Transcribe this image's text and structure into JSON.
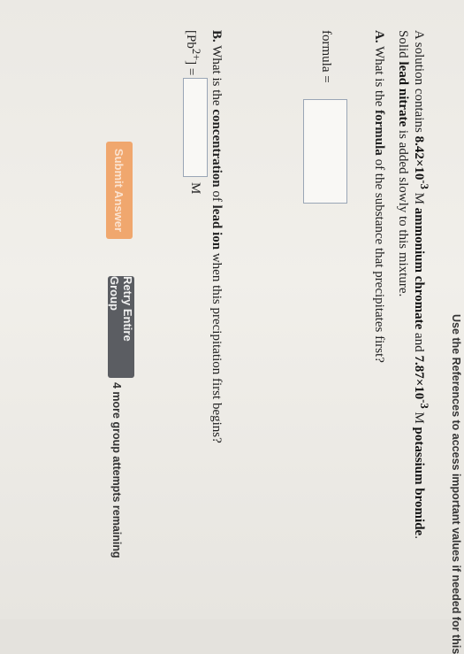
{
  "header": {
    "references_text": "Use the References to access important values if needed for this"
  },
  "problem": {
    "t1": "A solution contains ",
    "b1": "8.42×10",
    "e1": "-3",
    "t2": " M ",
    "b2": "ammonium chromate",
    "t3": " and ",
    "b3": "7.87×10",
    "e3": "-3",
    "t4": " M ",
    "b4": "potassium bromide",
    "t5": ".",
    "t6": "Solid ",
    "b6": "lead nitrate",
    "t7": " is added slowly to this mixture."
  },
  "part_a": {
    "label": "A.",
    "pre": " What is the ",
    "bold": "formula",
    "post": " of the substance that precipitates first?",
    "field_label": "formula =",
    "value": ""
  },
  "part_b": {
    "label": "B.",
    "pre": " What is the ",
    "bold1": "concentration",
    "mid": " of ",
    "bold2": "lead ion",
    "post": " when this precipitation first begins?",
    "field_label_pre": "[Pb",
    "field_label_sup": "2+",
    "field_label_post": "] =",
    "value": "",
    "unit": "M"
  },
  "buttons": {
    "submit": "Submit Answer",
    "retry": "Retry Entire Group"
  },
  "attempts_text": "4 more group attempts remaining"
}
